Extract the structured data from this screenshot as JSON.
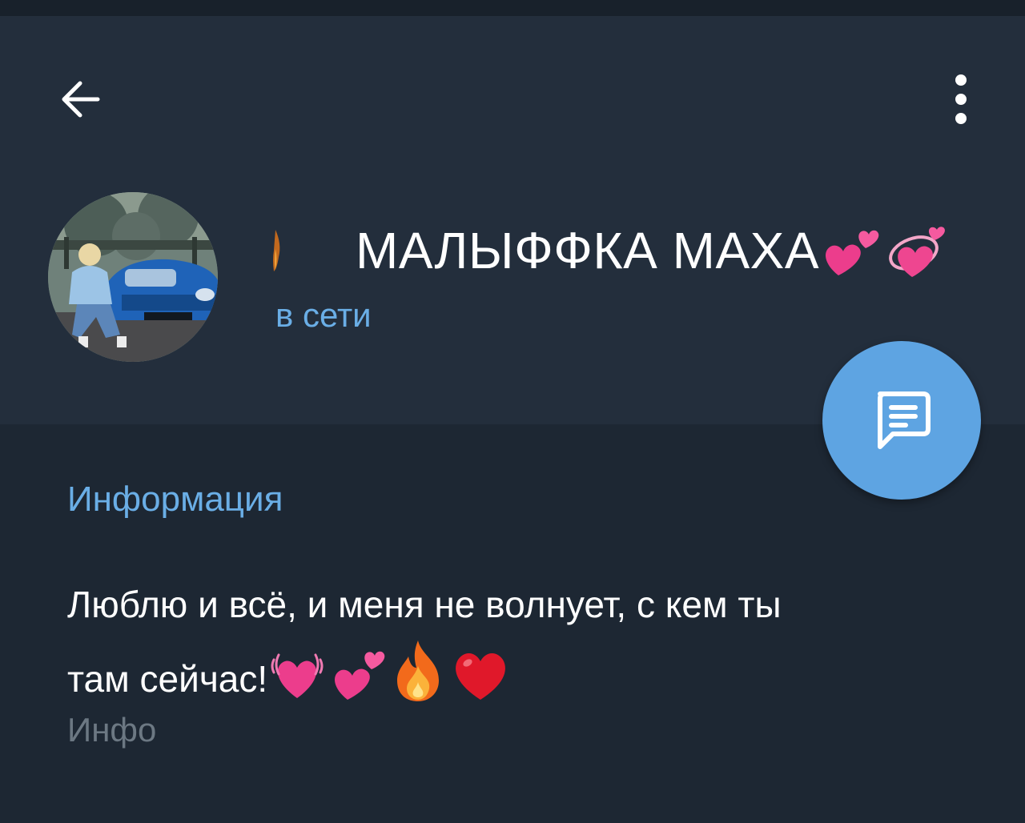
{
  "toolbar": {
    "back_icon": "arrow-left-icon",
    "menu_icon": "more-vertical-icon"
  },
  "profile": {
    "avatar_description": "photo",
    "name": "МАЛЫФФКА МАХА",
    "name_emojis": [
      "two-hearts-emoji",
      "revolving-hearts-emoji"
    ],
    "status": "в сети"
  },
  "fab": {
    "icon": "message-icon"
  },
  "info": {
    "section_title": "Информация",
    "bio_line1": "Люблю и всё, и меня не волнует, с кем ты",
    "bio_line2": "там сейчас!",
    "bio_emojis": [
      "beating-heart-emoji",
      "two-hearts-emoji",
      "fire-emoji",
      "red-heart-emoji"
    ],
    "caption": "Инфо"
  },
  "colors": {
    "background": "#1d2733",
    "header": "#232e3c",
    "accent": "#6aaee6",
    "fab": "#5ea4e2",
    "secondary_text": "#6c7883"
  }
}
